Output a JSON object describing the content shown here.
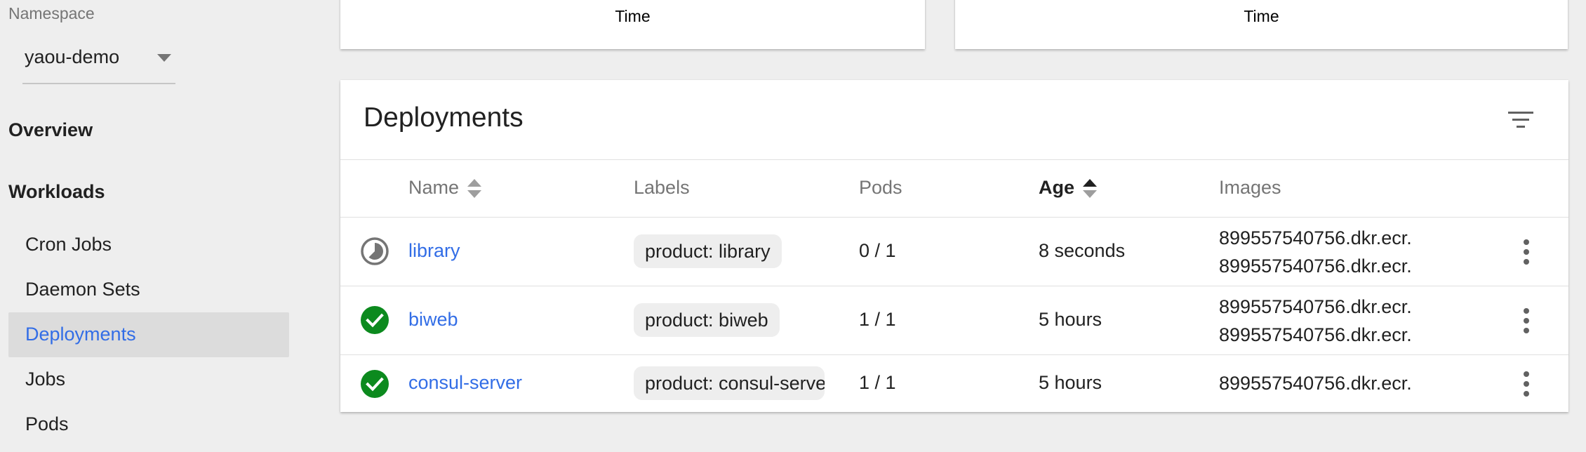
{
  "sidebar": {
    "namespace_label": "Namespace",
    "namespace_value": "yaou-demo",
    "overview": "Overview",
    "workloads": "Workloads",
    "items": [
      {
        "label": "Cron Jobs"
      },
      {
        "label": "Daemon Sets"
      },
      {
        "label": "Deployments",
        "active": true
      },
      {
        "label": "Jobs"
      },
      {
        "label": "Pods"
      }
    ]
  },
  "charts": {
    "left_axis_title": "Time",
    "right_axis_title": "Time"
  },
  "deployments": {
    "title": "Deployments",
    "columns": {
      "name": "Name",
      "labels": "Labels",
      "pods": "Pods",
      "age": "Age",
      "images": "Images"
    },
    "sorted_column": "age",
    "rows": [
      {
        "status": "pending",
        "name": "library",
        "label": "product: library",
        "pods": "0 / 1",
        "age": "8 seconds",
        "image1": "899557540756.dkr.ecr.",
        "image2": "899557540756.dkr.ecr."
      },
      {
        "status": "running",
        "name": "biweb",
        "label": "product: biweb",
        "pods": "1 / 1",
        "age": "5 hours",
        "image1": "899557540756.dkr.ecr.",
        "image2": "899557540756.dkr.ecr."
      },
      {
        "status": "running",
        "name": "consul-server",
        "label": "product: consul-serve",
        "pods": "1 / 1",
        "age": "5 hours",
        "image1": "899557540756.dkr.ecr."
      }
    ]
  },
  "colors": {
    "accent": "#326de6",
    "success": "#0c8a1e",
    "pending": "#757575",
    "background": "#eeeeee"
  }
}
